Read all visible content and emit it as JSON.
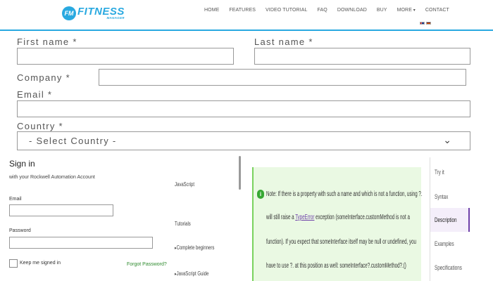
{
  "header": {
    "logo_badge": "FM",
    "logo_main": "FITNESS",
    "logo_sub": "MANAGER",
    "nav": [
      "HOME",
      "FEATURES",
      "VIDEO TUTORIAL",
      "FAQ",
      "DOWNLOAD",
      "BUY",
      "MORE",
      "CONTACT"
    ],
    "accent_color": "#29a9e0"
  },
  "registration": {
    "first_name_label": "First name *",
    "last_name_label": "Last name *",
    "company_label": "Company *",
    "email_label": "Email *",
    "country_label": "Country *",
    "country_selected": "- Select Country -"
  },
  "signin": {
    "title": "Sign in",
    "subtitle": "with your Rockwell Automation Account",
    "email_label": "Email",
    "password_label": "Password",
    "keep_signed_in": "Keep me signed in",
    "forgot_password": "Forgot Password?"
  },
  "sidebar": {
    "items": [
      "JavaScript",
      "Tutorials",
      "Complete beginners",
      "JavaScript Guide"
    ]
  },
  "note": {
    "icon": "i",
    "line1": "Note: If there is a property with such a name and which is not a function, using ?.",
    "line2_a": "will still raise a ",
    "line2_link": "TypeError",
    "line2_b": " exception (someInterface.customMethod is not a",
    "line3": "function). If you expect that someInterface itself may be null or undefined, you",
    "line4": "have to use ?. at this position as well: someInterface?.customMethod?.()"
  },
  "right_tabs": {
    "items": [
      "Try it",
      "Syntax",
      "Description",
      "Examples",
      "Specifications"
    ],
    "active": "Description"
  }
}
